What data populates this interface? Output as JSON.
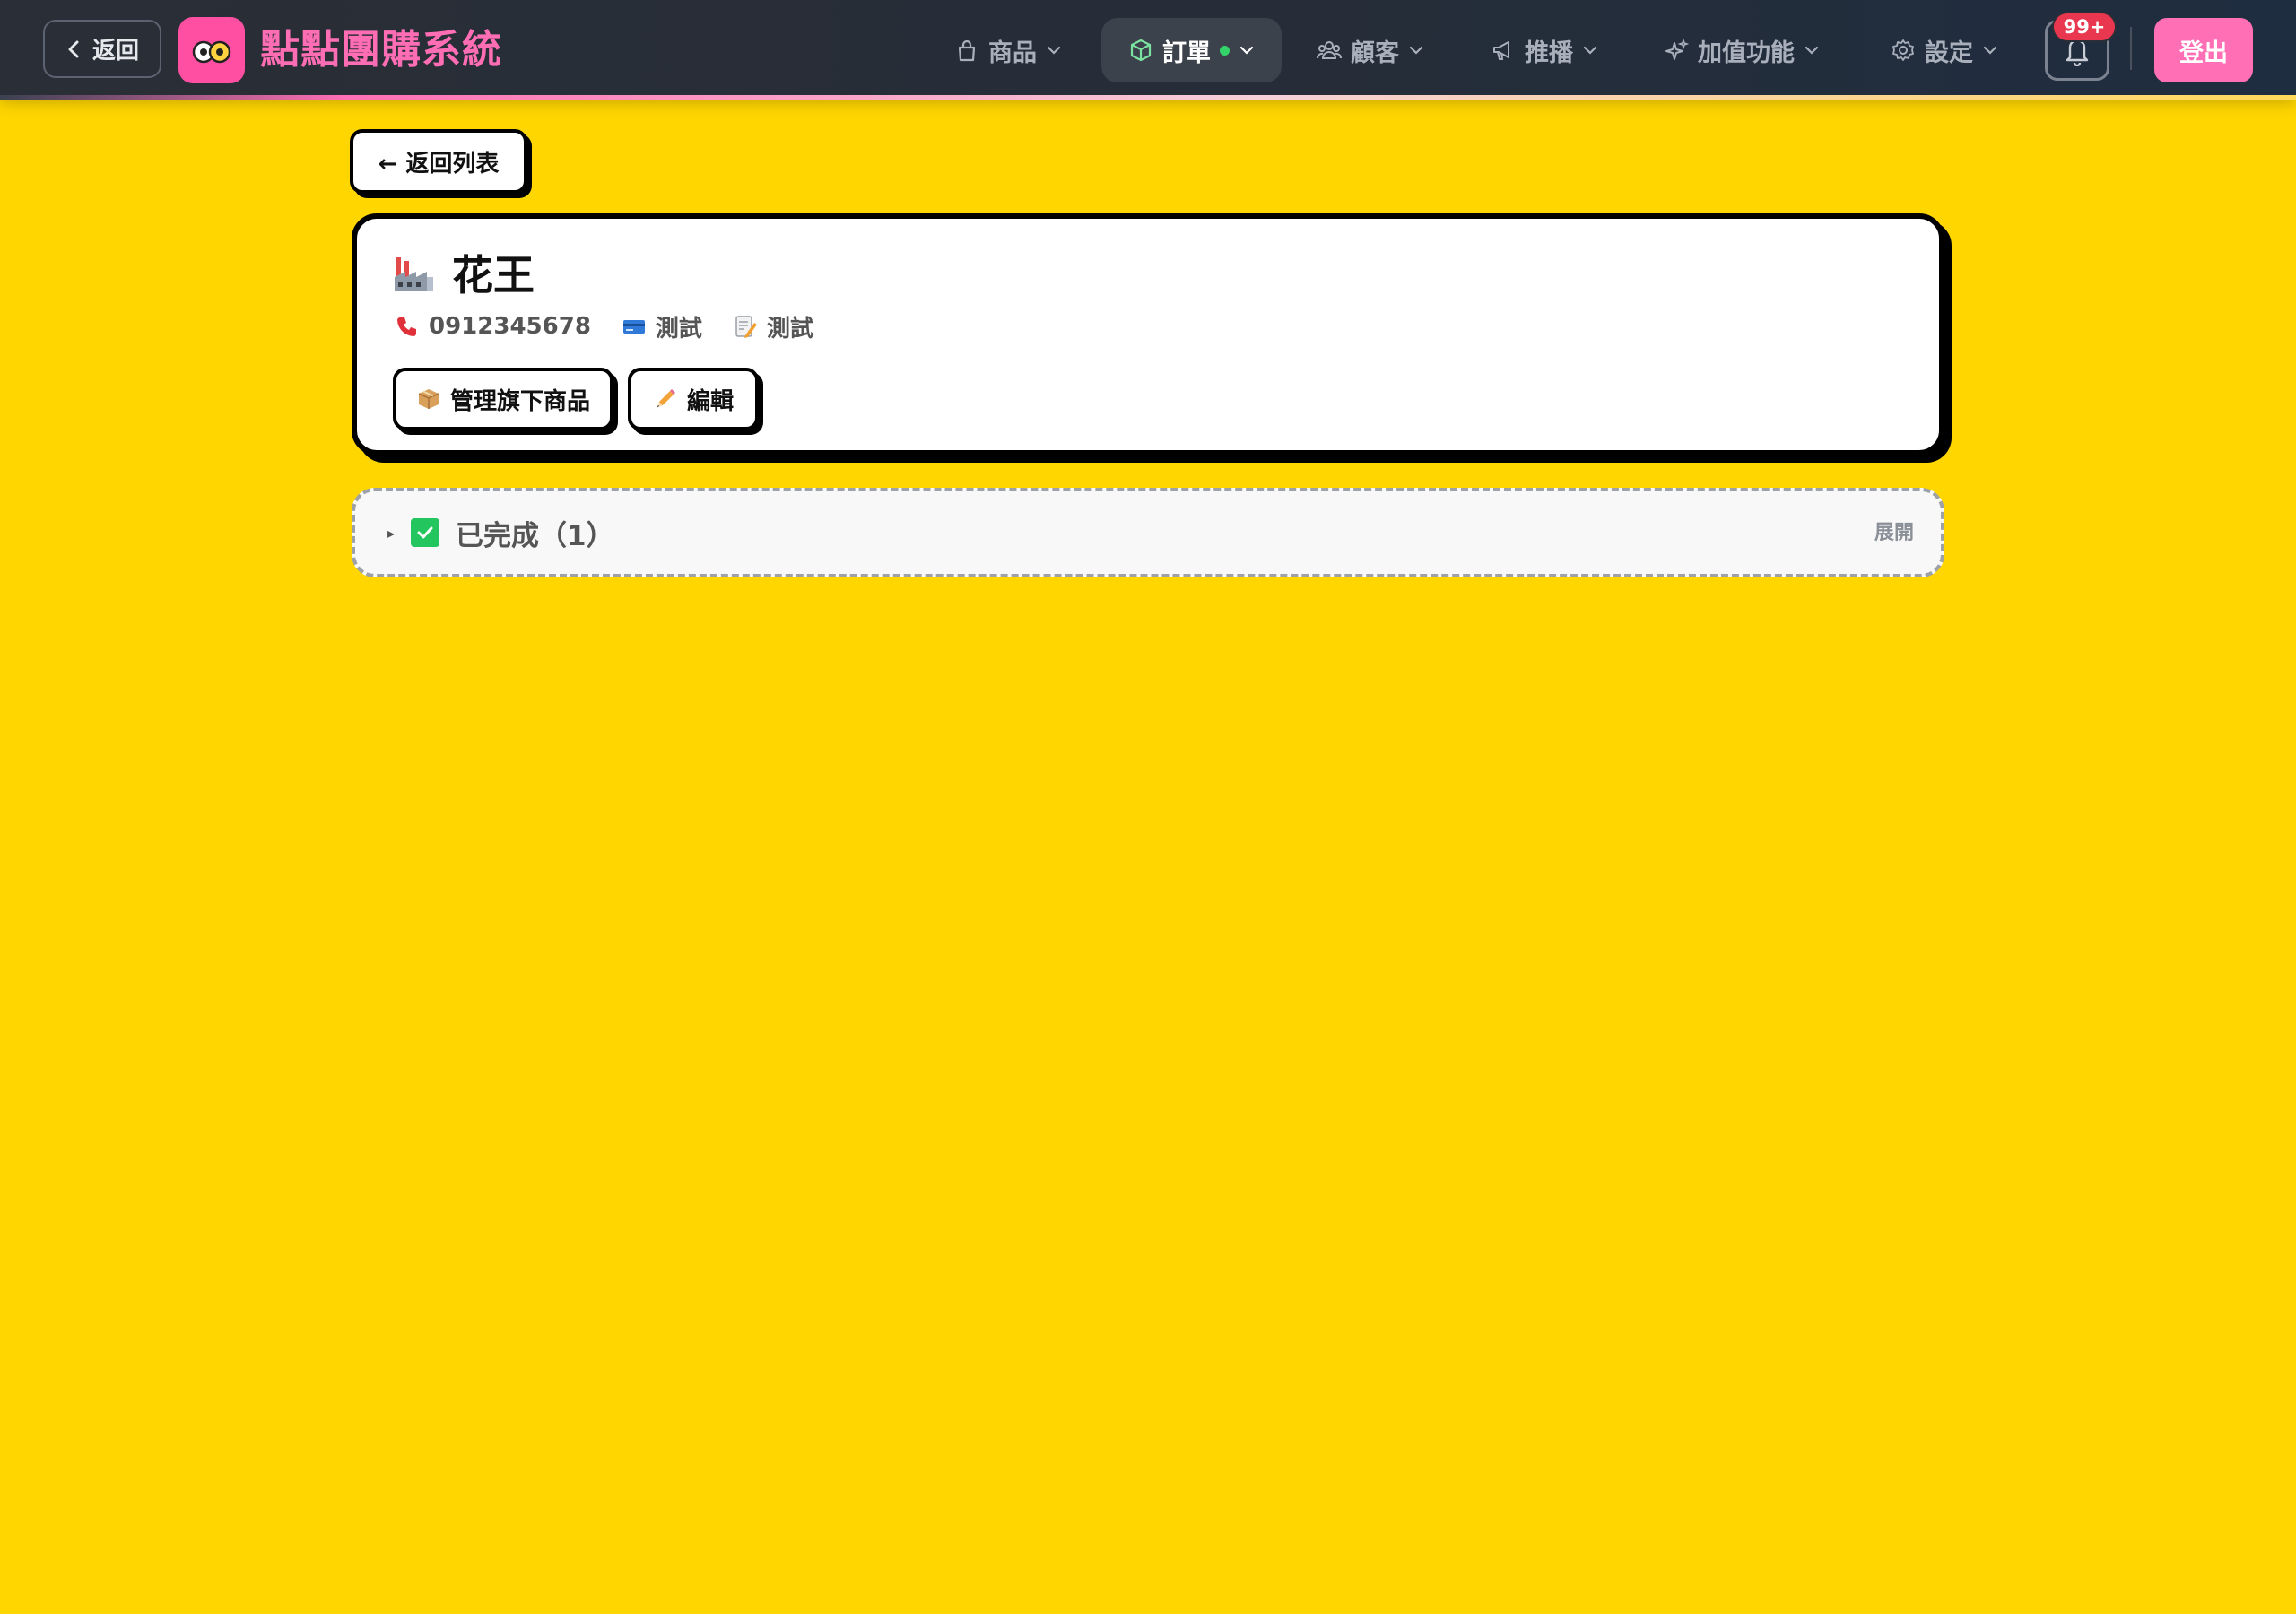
{
  "header": {
    "back_label": "返回",
    "brand": "點點團購系統",
    "menu": [
      {
        "label": "商品",
        "icon": "bag-icon"
      },
      {
        "label": "訂單",
        "icon": "box-icon"
      },
      {
        "label": "顧客",
        "icon": "users-icon"
      },
      {
        "label": "推播",
        "icon": "megaphone-icon"
      },
      {
        "label": "加值功能",
        "icon": "sparkles-icon"
      },
      {
        "label": "設定",
        "icon": "gear-icon"
      }
    ],
    "active_menu": "訂單",
    "notification_badge": "99+",
    "logout_label": "登出"
  },
  "page": {
    "back_to_list": "← 返回列表",
    "supplier": {
      "name": "花王",
      "phone": "0912345678",
      "account": "測試",
      "note": "測試",
      "manage_button": "管理旗下商品",
      "edit_button": "編輯"
    },
    "section": {
      "title": "已完成（1）",
      "toggle_label": "展開"
    }
  },
  "colors": {
    "page_bg": "#FFD600",
    "brand_pink": "#ff6eb4",
    "nav_bg": "#2a2e36",
    "check_green": "#22c55e",
    "badge_red": "#e8374f"
  }
}
